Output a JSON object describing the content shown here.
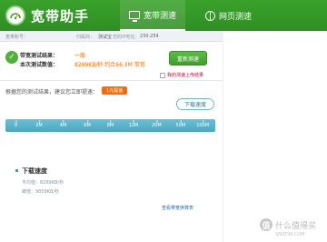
{
  "header": {
    "title": "宽带助手",
    "tabs": [
      {
        "label": "宽带测速",
        "icon": "monitor-icon"
      },
      {
        "label": "网页测速",
        "icon": "globe-icon"
      }
    ]
  },
  "info_bar": {
    "account_label": "宽带账号：",
    "operator_label": "归属商：",
    "operator_value": "测试宝",
    "ip_label": "您的IP地址：",
    "ip_value": "230.254"
  },
  "result": {
    "label_1": "带宽测试结果：",
    "value_1": "一般",
    "label_2": "本次测试数值：",
    "value_2": "8299KB/秒 约合66.3M 带宽",
    "retest_label": "重新测速",
    "checkbox_label": "我的测速上传结果",
    "checkbox_checked": false
  },
  "suggestion": {
    "text": "根据您的测试结果，建议您立即提速：",
    "tag": "1元提速"
  },
  "download_chip": "下载速度",
  "scale": {
    "ticks": [
      "0",
      "2M",
      "4M",
      "6M",
      "8M",
      "12M",
      "20M",
      "50M",
      "100M"
    ]
  },
  "download": {
    "title": "下载速度",
    "avg": "平均值：8299KB/秒",
    "peak": "峰值：9859KB/秒",
    "link": "查看带宽换算表"
  },
  "watermark": {
    "badge": "值",
    "text": "什么值得买",
    "sub": "SMZDM.COM"
  }
}
